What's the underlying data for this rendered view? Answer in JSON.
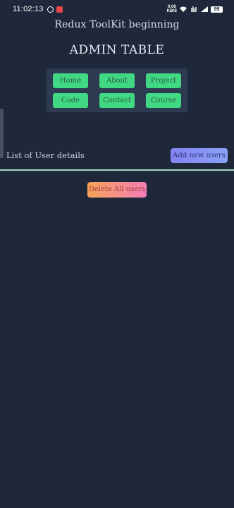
{
  "status_bar": {
    "time": "11:02:13",
    "net_speed_value": "0.06",
    "net_speed_unit": "KB/S",
    "battery": "99",
    "icons": [
      "whatsapp-icon",
      "notification-icon",
      "wifi-icon",
      "volte-icon",
      "signal-icon",
      "battery-icon"
    ]
  },
  "header": {
    "app_heading": "Redux ToolKit beginning",
    "admin_title": "ADMIN TABLE"
  },
  "nav": {
    "items": [
      {
        "label": "Home"
      },
      {
        "label": "About"
      },
      {
        "label": "Project"
      },
      {
        "label": "Code"
      },
      {
        "label": "Contact"
      },
      {
        "label": "Course"
      }
    ]
  },
  "users_section": {
    "label": "List of User details",
    "add_button": "Add new users",
    "delete_button": "Delete All users"
  },
  "colors": {
    "background": "#1f283a",
    "nav_panel": "#2c3b50",
    "nav_button": "#41d884",
    "add_button_gradient": [
      "#8583f5",
      "#8aa2f7"
    ],
    "delete_button_gradient": [
      "#f6a35a",
      "#f47eb6"
    ],
    "divider": "#a4d6c2"
  }
}
